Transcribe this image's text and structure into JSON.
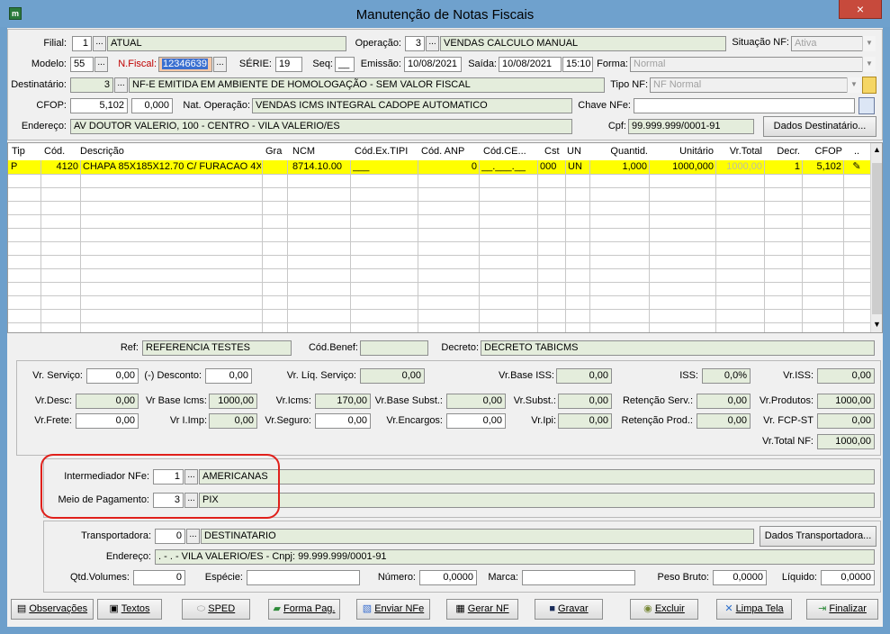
{
  "window": {
    "title": "Manutenção de Notas Fiscais",
    "close": "×"
  },
  "header": {
    "filial_label": "Filial:",
    "filial_code": "1",
    "filial_name": "ATUAL",
    "operacao_label": "Operação:",
    "operacao_code": "3",
    "operacao_name": "VENDAS CALCULO MANUAL",
    "situacao_label": "Situação NF:",
    "situacao_value": "Ativa",
    "modelo_label": "Modelo:",
    "modelo_value": "55",
    "nfiscal_label": "N.Fiscal:",
    "nfiscal_value": "12346639",
    "serie_label": "SÉRIE:",
    "serie_value": "19",
    "seq_label": "Seq:",
    "seq_value": "__",
    "emissao_label": "Emissão:",
    "emissao_value": "10/08/2021",
    "saida_label": "Saída:",
    "saida_date": "10/08/2021",
    "saida_time": "15:10",
    "forma_label": "Forma:",
    "forma_value": "Normal",
    "destinatario_label": "Destinatário:",
    "destinatario_code": "3",
    "destinatario_name": "NF-E EMITIDA EM AMBIENTE DE HOMOLOGAÇÃO - SEM VALOR FISCAL",
    "tiponf_label": "Tipo NF:",
    "tiponf_value": "NF Normal",
    "cfop_label": "CFOP:",
    "cfop_value": "5,102",
    "cfop_extra": "0,000",
    "natop_label": "Nat. Operação:",
    "natop_value": "VENDAS ICMS INTEGRAL CADOPE AUTOMATICO",
    "chave_label": "Chave NFe:",
    "chave_value": "",
    "endereco_label": "Endereço:",
    "endereco_value": "AV DOUTOR VALERIO, 100 - CENTRO - VILA VALERIO/ES",
    "cpf_label": "Cpf:",
    "cpf_value": "99.999.999/0001-91",
    "dados_dest_btn": "Dados Destinatário..."
  },
  "grid": {
    "columns": [
      "Tip",
      "Cód.",
      "Descrição",
      "Gra",
      "NCM",
      "Cód.Ex.TIPI",
      "Cód. ANP",
      "Cód.CE...",
      "Cst",
      "UN",
      "Quantid.",
      "Unitário",
      "Vr.Total",
      "Decr.",
      "CFOP",
      ".."
    ],
    "row": {
      "tip": "P",
      "cod": "4120",
      "descricao": "CHAPA 85X185X12.70 C/ FURACAO 4X",
      "gra": "",
      "ncm": "8714.10.00",
      "exTipi": "___",
      "anp": "0",
      "ce": "__.___.__",
      "cst": "000",
      "un": "UN",
      "quant": "1,000",
      "unit": "1000,000",
      "total": "1000,00",
      "decr": "1",
      "cfop": "5,102"
    }
  },
  "refs": {
    "ref_label": "Ref:",
    "ref_value": "REFERENCIA TESTES",
    "codbenef_label": "Cód.Benef:",
    "codbenef_value": "",
    "decreto_label": "Decreto:",
    "decreto_value": "DECRETO TABICMS"
  },
  "totals": {
    "vr_servico_label": "Vr. Serviço:",
    "vr_servico": "0,00",
    "desconto_label": "(-) Desconto:",
    "desconto": "0,00",
    "liq_servico_label": "Vr. Líq. Serviço:",
    "liq_servico": "0,00",
    "base_iss_label": "Vr.Base ISS:",
    "base_iss": "0,00",
    "iss_label": "ISS:",
    "iss": "0,0%",
    "vr_iss_label": "Vr.ISS:",
    "vr_iss": "0,00",
    "vr_desc_label": "Vr.Desc:",
    "vr_desc": "0,00",
    "base_icms_label": "Vr Base Icms:",
    "base_icms": "1000,00",
    "icms_label": "Vr.Icms:",
    "icms": "170,00",
    "base_subst_label": "Vr.Base Subst.:",
    "base_subst": "0,00",
    "subst_label": "Vr.Subst.:",
    "subst": "0,00",
    "ret_serv_label": "Retenção Serv.:",
    "ret_serv": "0,00",
    "produtos_label": "Vr.Produtos:",
    "produtos": "1000,00",
    "frete_label": "Vr.Frete:",
    "frete": "0,00",
    "imp_label": "Vr I.Imp:",
    "imp": "0,00",
    "seguro_label": "Vr.Seguro:",
    "seguro": "0,00",
    "encargos_label": "Vr.Encargos:",
    "encargos": "0,00",
    "ipi_label": "Vr.Ipi:",
    "ipi": "0,00",
    "ret_prod_label": "Retenção Prod.:",
    "ret_prod": "0,00",
    "fcp_label": "Vr. FCP-ST",
    "fcp": "0,00",
    "total_nf_label": "Vr.Total NF:",
    "total_nf": "1000,00"
  },
  "payment": {
    "intermediador_label": "Intermediador NFe:",
    "intermediador_code": "1",
    "intermediador_name": "AMERICANAS",
    "meio_label": "Meio de Pagamento:",
    "meio_code": "3",
    "meio_name": "PIX"
  },
  "transport": {
    "transportadora_label": "Transportadora:",
    "transportadora_code": "0",
    "transportadora_name": "DESTINATARIO",
    "dados_transp_btn": "Dados Transportadora...",
    "endereco_label": "Endereço:",
    "endereco_value": ". - . - VILA VALERIO/ES - Cnpj: 99.999.999/0001-91",
    "qtd_label": "Qtd.Volumes:",
    "qtd": "0",
    "especie_label": "Espécie:",
    "especie": "",
    "numero_label": "Número:",
    "numero": "0,0000",
    "marca_label": "Marca:",
    "marca": "",
    "peso_bruto_label": "Peso Bruto:",
    "peso_bruto": "0,0000",
    "liquido_label": "Líquido:",
    "liquido": "0,0000"
  },
  "toolbar": {
    "observacoes": "Observações",
    "textos": "Textos",
    "sped": "SPED",
    "forma_pag": "Forma Pag.",
    "enviar_nfe": "Enviar NFe",
    "gerar_nf": "Gerar NF",
    "gravar": "Gravar",
    "excluir": "Excluir",
    "limpa_tela": "Limpa Tela",
    "finalizar": "Finalizar"
  },
  "dots_label": "...",
  "colors": {
    "input_green": "#e4eddc",
    "grid_row": "#ffff00",
    "highlight": "#e0201b",
    "titlebar": "#6fa1cd"
  }
}
